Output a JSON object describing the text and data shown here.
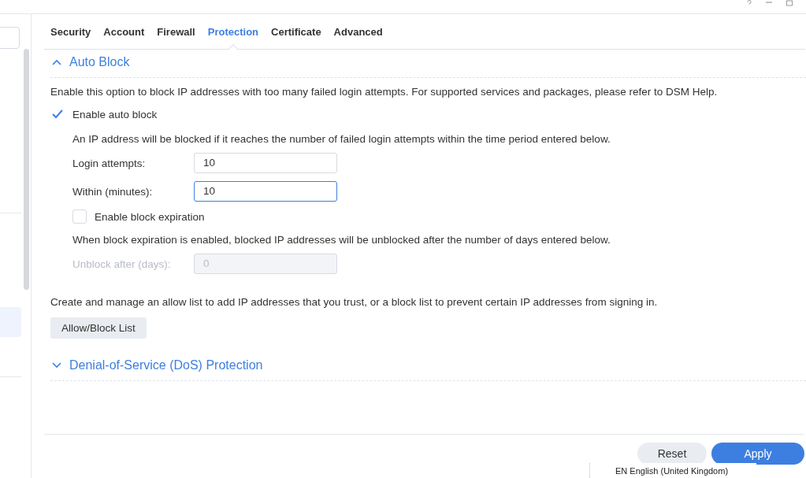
{
  "tabs": [
    {
      "label": "Security",
      "selected": false
    },
    {
      "label": "Account",
      "selected": false
    },
    {
      "label": "Firewall",
      "selected": false
    },
    {
      "label": "Protection",
      "selected": true
    },
    {
      "label": "Certificate",
      "selected": false
    },
    {
      "label": "Advanced",
      "selected": false
    }
  ],
  "auto_block": {
    "title": "Auto Block",
    "expanded": true,
    "description": "Enable this option to block IP addresses with too many failed login attempts. For supported services and packages, please refer to DSM Help.",
    "enable": {
      "label": "Enable auto block",
      "checked": true
    },
    "info": "An IP address will be blocked if it reaches the number of failed login attempts within the time period entered below.",
    "fields": [
      {
        "label": "Login attempts:",
        "value": "10",
        "focused": false
      },
      {
        "label": "Within (minutes):",
        "value": "10",
        "focused": true
      }
    ],
    "expiration": {
      "label": "Enable block expiration",
      "checked": false
    },
    "expiration_info": "When block expiration is enabled, blocked IP addresses will be unblocked after the number of days entered below.",
    "unblock": {
      "label": "Unblock after (days):",
      "value": "0",
      "disabled": true
    },
    "allow_text": "Create and manage an allow list to add IP addresses that you trust, or a block list to prevent certain IP addresses from signing in.",
    "allow_button": "Allow/Block List"
  },
  "dos": {
    "title": "Denial-of-Service (DoS) Protection",
    "expanded": false
  },
  "footer_buttons": [
    {
      "label": "Reset",
      "kind": "secondary"
    },
    {
      "label": "Apply",
      "kind": "primary"
    }
  ],
  "language_bar": {
    "text": "EN English (United Kingdom)"
  }
}
